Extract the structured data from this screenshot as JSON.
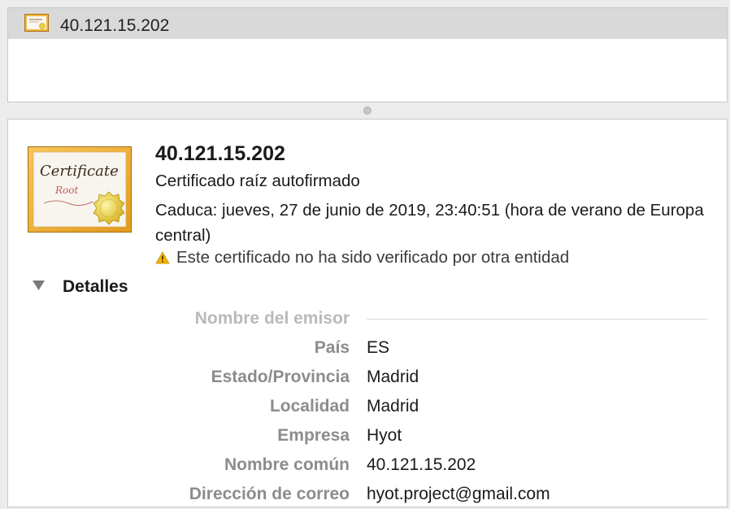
{
  "list": {
    "items": [
      {
        "title": "40.121.15.202",
        "icon": "certificate-icon"
      }
    ]
  },
  "certificate": {
    "name": "40.121.15.202",
    "type": "Certificado raíz autofirmado",
    "expiry": "Caduca: jueves, 27 de junio de 2019, 23:40:51 (hora de verano de Europa central)",
    "warning": "Este certificado no ha sido verificado por otra entidad",
    "icon_text": {
      "title": "Certificate",
      "subtitle": "Root"
    }
  },
  "details": {
    "label": "Detalles",
    "expanded": true,
    "section_title": "Nombre del emisor",
    "fields": [
      {
        "label": "País",
        "value": "ES"
      },
      {
        "label": "Estado/Provincia",
        "value": "Madrid"
      },
      {
        "label": "Localidad",
        "value": "Madrid"
      },
      {
        "label": "Empresa",
        "value": "Hyot"
      },
      {
        "label": "Nombre común",
        "value": "40.121.15.202"
      },
      {
        "label": "Dirección de correo",
        "value": "hyot.project@gmail.com"
      }
    ]
  },
  "colors": {
    "warning": "#f0b400",
    "selection": "#d9d9d9",
    "label_gray": "#8c8c8c",
    "section_gray": "#b9b9b9"
  }
}
